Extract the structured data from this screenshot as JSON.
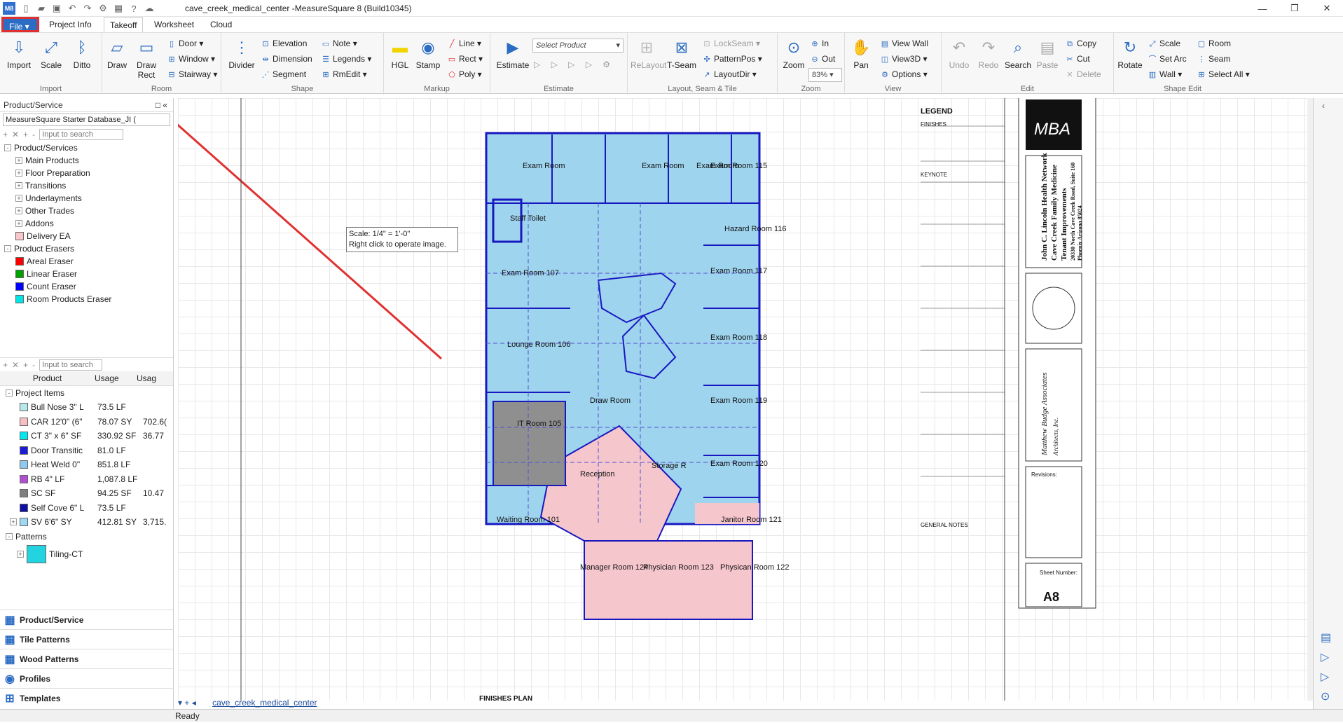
{
  "window": {
    "title": "cave_creek_medical_center -MeasureSquare 8 (Build10345)",
    "app_icon": "M8"
  },
  "tabs": {
    "file": "File",
    "project_info": "Project Info",
    "takeoff": "Takeoff",
    "worksheet": "Worksheet",
    "cloud": "Cloud"
  },
  "ribbon": {
    "import": {
      "label": "Import",
      "btn_import": "Import",
      "btn_scale": "Scale",
      "btn_ditto": "Ditto"
    },
    "room": {
      "label": "Room",
      "btn_draw": "Draw",
      "btn_draw_rect": "Draw Rect",
      "door": "Door",
      "window": "Window",
      "stairway": "Stairway"
    },
    "shape": {
      "label": "Shape",
      "btn_divider": "Divider",
      "elevation": "Elevation",
      "dimension": "Dimension",
      "segment": "Segment",
      "note": "Note",
      "legends": "Legends",
      "rmedit": "RmEdit"
    },
    "markup": {
      "label": "Markup",
      "btn_hgl": "HGL",
      "btn_stamp": "Stamp",
      "line": "Line",
      "rect": "Rect",
      "poly": "Poly"
    },
    "estimate": {
      "label": "Estimate",
      "btn_estimate": "Estimate",
      "select_product": "Select Product"
    },
    "layout": {
      "label": "Layout, Seam & Tile",
      "btn_relayout": "ReLayout",
      "btn_tseam": "T-Seam",
      "lockseam": "LockSeam",
      "patternpos": "PatternPos",
      "layoutdir": "LayoutDir"
    },
    "zoom": {
      "label": "Zoom",
      "btn_zoom": "Zoom",
      "in": "In",
      "out": "Out",
      "level": "83%"
    },
    "view": {
      "label": "View",
      "btn_pan": "Pan",
      "view_wall": "View Wall",
      "view3d": "View3D",
      "options": "Options"
    },
    "edit": {
      "label": "Edit",
      "btn_undo": "Undo",
      "btn_redo": "Redo",
      "btn_search": "Search",
      "btn_paste": "Paste",
      "copy": "Copy",
      "cut": "Cut",
      "delete": "Delete"
    },
    "shape_edit": {
      "label": "Shape Edit",
      "btn_rotate": "Rotate",
      "scale": "Scale",
      "set_arc": "Set Arc",
      "wall": "Wall",
      "room": "Room",
      "seam": "Seam",
      "select_all": "Select All"
    }
  },
  "panel": {
    "title": "Product/Service",
    "database": "MeasureSquare Starter Database_JI (",
    "search_placeholder": "Input to search",
    "tree": [
      {
        "label": "Product/Services",
        "level": 0,
        "expander": "-"
      },
      {
        "label": "Main Products",
        "level": 1,
        "expander": "+"
      },
      {
        "label": "Floor Preparation",
        "level": 1,
        "expander": "+"
      },
      {
        "label": "Transitions",
        "level": 1,
        "expander": "+"
      },
      {
        "label": "Underlayments",
        "level": 1,
        "expander": "+"
      },
      {
        "label": "Other Trades",
        "level": 1,
        "expander": "+"
      },
      {
        "label": "Addons",
        "level": 1,
        "expander": "+"
      },
      {
        "label": "Delivery  EA",
        "level": 1,
        "swatch": "#f9c6c9"
      },
      {
        "label": "Product Erasers",
        "level": 0,
        "expander": "-"
      },
      {
        "label": "Areal Eraser",
        "level": 1,
        "swatch": "#ff0000"
      },
      {
        "label": "Linear Eraser",
        "level": 1,
        "swatch": "#00a000"
      },
      {
        "label": "Count Eraser",
        "level": 1,
        "swatch": "#0000ff"
      },
      {
        "label": "Room Products Eraser",
        "level": 1,
        "swatch": "#00e5e5"
      }
    ],
    "table_headers": {
      "product": "Product",
      "usage": "Usage",
      "usage2": "Usag"
    },
    "project_items_label": "Project Items",
    "rows": [
      {
        "name": "Bull Nose 3\" L",
        "usage": "73.5 LF",
        "usage2": "",
        "swatch": "#b9e8ea"
      },
      {
        "name": "CAR 12'0\" (6\"",
        "usage": "78.07 SY",
        "usage2": "702.6(",
        "swatch": "#f7bfc4"
      },
      {
        "name": "CT 3\" x 6\" SF",
        "usage": "330.92 SF",
        "usage2": "36.77",
        "swatch": "#00e8f0"
      },
      {
        "name": "Door Transitic",
        "usage": "81.0 LF",
        "usage2": "",
        "swatch": "#1a1ad8"
      },
      {
        "name": "Heat Weld 0\"",
        "usage": "851.8 LF",
        "usage2": "",
        "swatch": "#8ec9f0"
      },
      {
        "name": "RB 4\" LF",
        "usage": "1,087.8 LF",
        "usage2": "",
        "swatch": "#b24fd1"
      },
      {
        "name": "SC  SF",
        "usage": "94.25 SF",
        "usage2": "10.47",
        "swatch": "#808080"
      },
      {
        "name": "Self Cove 6\" L",
        "usage": "73.5 LF",
        "usage2": "",
        "swatch": "#1010a0"
      },
      {
        "name": "SV 6'6\" SY",
        "usage": "412.81 SY",
        "usage2": "3,715.",
        "swatch": "#9fd8f2",
        "expander": "+"
      }
    ],
    "patterns_label": "Patterns",
    "patterns": [
      {
        "name": "Tiling-CT"
      }
    ],
    "nav": [
      "Product/Service",
      "Tile Patterns",
      "Wood Patterns",
      "Profiles",
      "Templates"
    ]
  },
  "canvas": {
    "tooltip_line1": "Scale: 1/4\" = 1'-0\"",
    "tooltip_line2": "Right click to operate image.",
    "rooms": {
      "exam115": "Exam Room 115",
      "hazard116": "Hazard Room 116",
      "exam117": "Exam Room 117",
      "exam118": "Exam Room 118",
      "exam119": "Exam Room 119",
      "exam120": "Exam Room 120",
      "janitor121": "Janitor Room 121",
      "physician122": "Physican Room 122",
      "physician123": "Physician Room 123",
      "manager124": "Manager Room 124",
      "reception": "Reception",
      "waiting101": "Waiting Room 101",
      "it105": "IT Room 105",
      "lounge106": "Lounge Room 106",
      "draw104": "Draw Room",
      "storage": "Storage R",
      "staff_toilet": "Staff Toilet",
      "exam107": "Exam Room 107",
      "exam_top1": "Exam Room",
      "exam_top2": "Exam Room",
      "exam_top3": "Exam Room"
    },
    "titleblock": {
      "legend": "LEGEND",
      "finishes": "FINISHES",
      "keynote": "KEYNOTE",
      "general_notes": "GENERAL NOTES",
      "logo": "MBA",
      "project1": "John C. Lincoln Health Network",
      "project2": "Cave Creek Family Medicine",
      "project3": "Tenant Improvements",
      "address": "20330 North Cave Creek Road, Suite 160",
      "city": "Phoenix Arizona 85024",
      "architect": "Matthew Budge Associates",
      "architect_sub": "Architects, Inc.",
      "sheet_label": "Sheet Number:",
      "sheet_number": "A8",
      "revisions": "Revisions:",
      "plan_title": "FINISHES PLAN"
    }
  },
  "doc_tab": "cave_creek_medical_center",
  "status": "Ready"
}
